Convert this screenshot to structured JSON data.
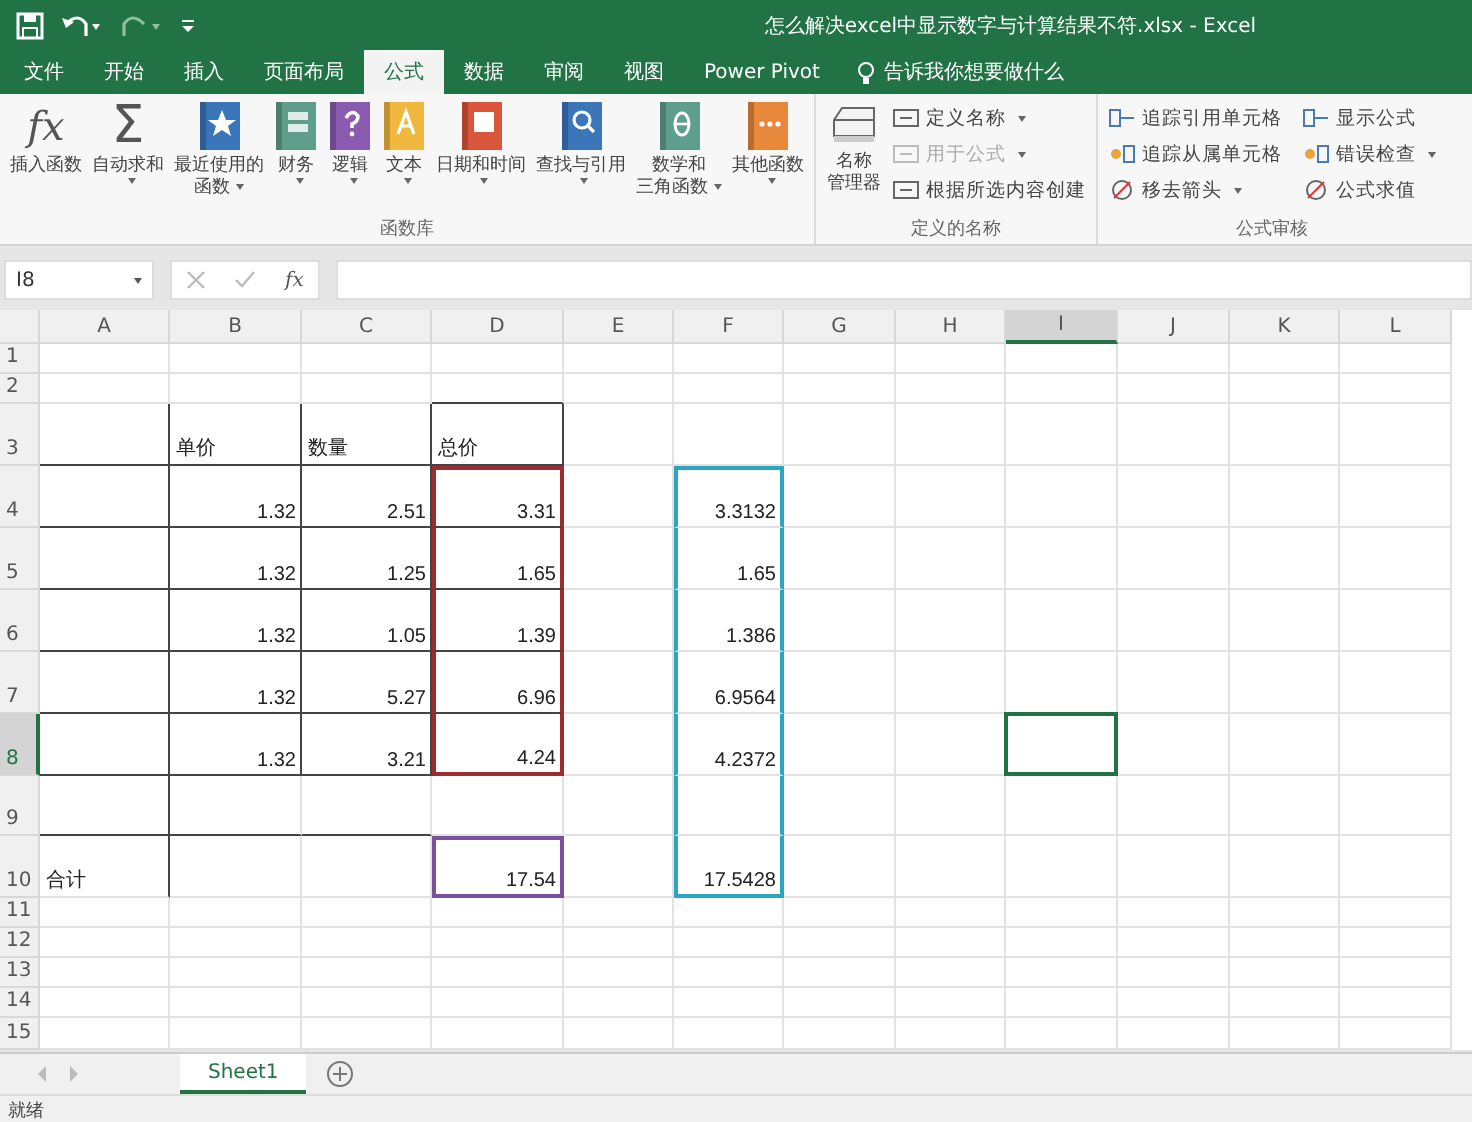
{
  "title_bar": {
    "title": "怎么解决excel中显示数字与计算结果不符.xlsx  -  Excel"
  },
  "ribbon_tabs": [
    {
      "label": "文件",
      "selected": false
    },
    {
      "label": "开始",
      "selected": false
    },
    {
      "label": "插入",
      "selected": false
    },
    {
      "label": "页面布局",
      "selected": false
    },
    {
      "label": "公式",
      "selected": true
    },
    {
      "label": "数据",
      "selected": false
    },
    {
      "label": "审阅",
      "selected": false
    },
    {
      "label": "视图",
      "selected": false
    },
    {
      "label": "Power Pivot",
      "selected": false
    }
  ],
  "tell_me": "告诉我你想要做什么",
  "function_library": {
    "label": "函数库",
    "buttons": [
      {
        "symbol": "fx",
        "lines": [
          "插入函数"
        ],
        "dropdown": false
      },
      {
        "symbol": "Σ",
        "lines": [
          "自动求和"
        ],
        "dropdown": true
      },
      {
        "lines": [
          "最近使用的",
          "函数"
        ],
        "dropdown": true
      },
      {
        "lines": [
          "财务"
        ],
        "dropdown": true
      },
      {
        "lines": [
          "逻辑"
        ],
        "dropdown": true
      },
      {
        "lines": [
          "文本"
        ],
        "dropdown": true
      },
      {
        "lines": [
          "日期和时间"
        ],
        "dropdown": true
      },
      {
        "lines": [
          "查找与引用"
        ],
        "dropdown": true
      },
      {
        "lines": [
          "数学和",
          "三角函数"
        ],
        "dropdown": true
      },
      {
        "lines": [
          "其他函数"
        ],
        "dropdown": true
      }
    ]
  },
  "defined_names": {
    "label": "定义的名称",
    "large": {
      "lines": [
        "名称",
        "管理器"
      ]
    },
    "items": [
      {
        "label": "定义名称",
        "dropdown": true,
        "disabled": false
      },
      {
        "label": "用于公式",
        "dropdown": true,
        "disabled": true
      },
      {
        "label": "根据所选内容创建",
        "dropdown": false,
        "disabled": false
      }
    ]
  },
  "formula_auditing": {
    "label": "公式审核",
    "items": [
      {
        "label": "追踪引用单元格",
        "dropdown": false
      },
      {
        "label": "追踪从属单元格",
        "dropdown": false
      },
      {
        "label": "移去箭头",
        "dropdown": true
      },
      {
        "label": "显示公式",
        "dropdown": false
      },
      {
        "label": "错误检查",
        "dropdown": true
      },
      {
        "label": "公式求值",
        "dropdown": false
      }
    ]
  },
  "formula_bar": {
    "name_box": "I8",
    "fx": "fx"
  },
  "columns": [
    {
      "label": "A",
      "selected": false
    },
    {
      "label": "B",
      "selected": false
    },
    {
      "label": "C",
      "selected": false
    },
    {
      "label": "D",
      "selected": false
    },
    {
      "label": "E",
      "selected": false
    },
    {
      "label": "F",
      "selected": false
    },
    {
      "label": "G",
      "selected": false
    },
    {
      "label": "H",
      "selected": false
    },
    {
      "label": "I",
      "selected": true
    },
    {
      "label": "J",
      "selected": false
    },
    {
      "label": "K",
      "selected": false
    },
    {
      "label": "L",
      "selected": false
    }
  ],
  "rows": [
    {
      "label": "1",
      "selected": false
    },
    {
      "label": "2",
      "selected": false
    },
    {
      "label": "3",
      "selected": false,
      "cells": [
        null,
        {
          "kind": "text",
          "value": "单价"
        },
        {
          "kind": "text",
          "value": "数量"
        },
        {
          "kind": "text",
          "value": "总价"
        }
      ]
    },
    {
      "label": "4",
      "selected": false,
      "cells": [
        null,
        {
          "kind": "number",
          "value": "1.32"
        },
        {
          "kind": "number",
          "value": "2.51"
        },
        {
          "kind": "number",
          "value": "3.31",
          "color": "#9b2d30"
        },
        null,
        {
          "kind": "number",
          "value": "3.3132",
          "color": "#2aa6c0"
        }
      ]
    },
    {
      "label": "5",
      "selected": false,
      "cells": [
        null,
        {
          "kind": "number",
          "value": "1.32"
        },
        {
          "kind": "number",
          "value": "1.25"
        },
        {
          "kind": "number",
          "value": "1.65",
          "color": "#9b2d30"
        },
        null,
        {
          "kind": "number",
          "value": "1.65",
          "color": "#2aa6c0"
        }
      ]
    },
    {
      "label": "6",
      "selected": false,
      "cells": [
        null,
        {
          "kind": "number",
          "value": "1.32"
        },
        {
          "kind": "number",
          "value": "1.05"
        },
        {
          "kind": "number",
          "value": "1.39",
          "color": "#9b2d30"
        },
        null,
        {
          "kind": "number",
          "value": "1.386",
          "color": "#2aa6c0"
        }
      ]
    },
    {
      "label": "7",
      "selected": false,
      "cells": [
        null,
        {
          "kind": "number",
          "value": "1.32"
        },
        {
          "kind": "number",
          "value": "5.27"
        },
        {
          "kind": "number",
          "value": "6.96",
          "color": "#9b2d30"
        },
        null,
        {
          "kind": "number",
          "value": "6.9564",
          "color": "#2aa6c0"
        }
      ]
    },
    {
      "label": "8",
      "selected": true,
      "cells": [
        null,
        {
          "kind": "number",
          "value": "1.32"
        },
        {
          "kind": "number",
          "value": "3.21"
        },
        {
          "kind": "number",
          "value": "4.24",
          "color": "#9b2d30"
        },
        null,
        {
          "kind": "number",
          "value": "4.2372",
          "color": "#2aa6c0"
        },
        null,
        null,
        {
          "selected": true
        }
      ]
    },
    {
      "label": "9",
      "selected": false,
      "cells": [
        null,
        null,
        null,
        null,
        null,
        {
          "color": "#2aa6c0"
        }
      ]
    },
    {
      "label": "10",
      "selected": false,
      "cells": [
        {
          "kind": "text",
          "value": "合计"
        },
        null,
        null,
        {
          "kind": "number",
          "value": "17.54",
          "color": "#7b4f9d"
        },
        null,
        {
          "kind": "number",
          "value": "17.5428",
          "color": "#2aa6c0"
        }
      ]
    },
    {
      "label": "11",
      "selected": false
    },
    {
      "label": "12",
      "selected": false
    },
    {
      "label": "13",
      "selected": false
    },
    {
      "label": "14",
      "selected": false
    },
    {
      "label": "15",
      "selected": false
    }
  ],
  "sheet_tabs": [
    {
      "label": "Sheet1",
      "selected": true
    }
  ],
  "status_bar": {
    "text": "就绪"
  }
}
